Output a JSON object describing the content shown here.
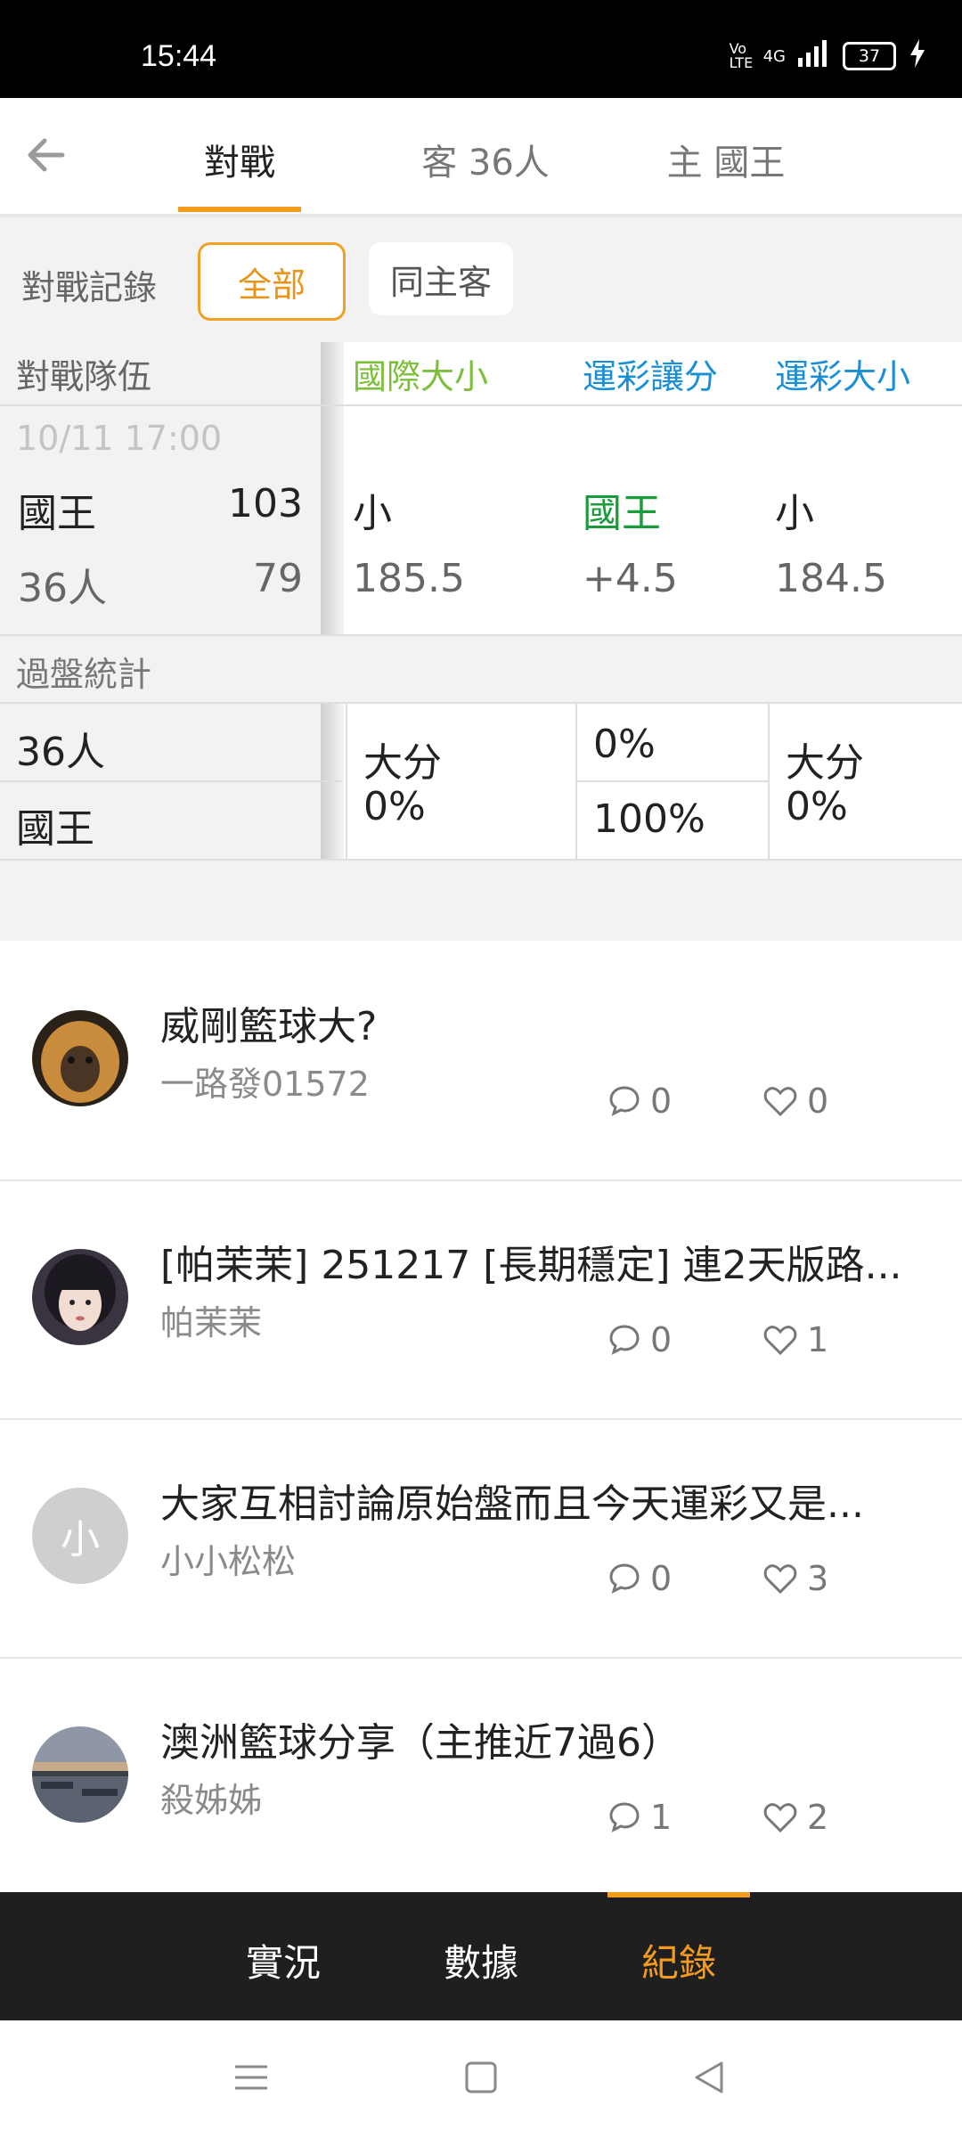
{
  "status": {
    "time": "15:44",
    "network": "4G",
    "volte": "Vo LTE",
    "battery": "37"
  },
  "header": {
    "tabs": [
      {
        "label": "對戰",
        "active": true
      },
      {
        "label": "客 36人",
        "active": false
      },
      {
        "label": "主 國王",
        "active": false
      }
    ]
  },
  "filter": {
    "label": "對戰記錄",
    "options": [
      "全部",
      "同主客"
    ],
    "selected": "全部"
  },
  "matchup": {
    "columns": [
      "對戰隊伍",
      "國際大小",
      "運彩讓分",
      "運彩大小"
    ],
    "column_colors": [
      "#666666",
      "#7cbf3a",
      "#1a8fd6",
      "#1a8fd6"
    ],
    "game": {
      "datetime": "10/11 17:00",
      "home": {
        "team": "國王",
        "score": "103",
        "intl_total": "小",
        "spread": "國王",
        "lottery_total": "小"
      },
      "away": {
        "team": "36人",
        "score": "79",
        "intl_total": "185.5",
        "spread": "+4.5",
        "lottery_total": "184.5"
      }
    },
    "stats_label": "過盤統計",
    "stats": {
      "teams": [
        "36人",
        "國王"
      ],
      "intl_total": {
        "label": "大分",
        "value": "0%"
      },
      "spread": {
        "top": "0%",
        "bottom": "100%"
      },
      "lottery_total": {
        "label": "大分",
        "value": "0%"
      }
    }
  },
  "posts": [
    {
      "title": "威剛籃球大?",
      "author": "一路發01572",
      "comments": "0",
      "likes": "0",
      "avatar": "monkey-photo"
    },
    {
      "title": "[帕茉茉] 251217 [長期穩定] 連2天版路...",
      "author": "帕茉茉",
      "comments": "0",
      "likes": "1",
      "avatar": "girl-photo"
    },
    {
      "title": "大家互相討論原始盤而且今天運彩又是...",
      "author": "小小松松",
      "comments": "0",
      "likes": "3",
      "avatar_letter": "小"
    },
    {
      "title": "澳洲籃球分享（主推近7過6）",
      "author": "殺姊姊",
      "comments": "1",
      "likes": "2",
      "avatar": "lake-photo"
    }
  ],
  "bottom_nav": {
    "items": [
      "實況",
      "數據",
      "紀錄"
    ],
    "active": "紀錄"
  },
  "colors": {
    "accent": "#f39b1d",
    "green": "#1a9c3a",
    "lightgreen": "#7cbf3a",
    "blue": "#1a8fd6"
  }
}
